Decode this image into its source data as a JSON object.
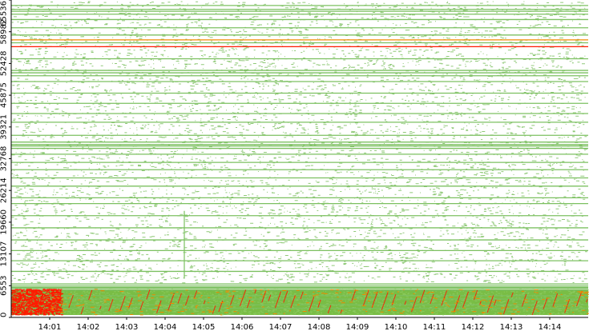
{
  "chart_data": {
    "type": "scatter",
    "y_axis": {
      "min": 0,
      "max": 65536,
      "ticks": [
        0,
        6553,
        13107,
        19660,
        26214,
        32768,
        39321,
        45875,
        52428,
        58982,
        65536
      ],
      "tick_labels": [
        "0",
        "6553",
        "13107",
        "19660",
        "26214",
        "32768",
        "39321",
        "45875",
        "52428",
        "58982",
        "65536"
      ]
    },
    "x_axis": {
      "min": "14:00",
      "max": "14:15",
      "ticks": [
        "14:01",
        "14:02",
        "14:03",
        "14:04",
        "14:05",
        "14:06",
        "14:07",
        "14:08",
        "14:09",
        "14:10",
        "14:11",
        "14:12",
        "14:13",
        "14:14"
      ],
      "tick_labels": [
        "14:01",
        "14:02",
        "14:03",
        "14:04",
        "14:05",
        "14:06",
        "14:07",
        "14:08",
        "14:09",
        "14:10",
        "14:11",
        "14:12",
        "14:13",
        "14:14"
      ]
    },
    "grid": false,
    "colors": {
      "normal": "#7cc060",
      "dense": "#6ab631",
      "hot": "#ff1a00",
      "line_orange": "#f08a00",
      "background": "#ffffff",
      "axis": "#000000"
    },
    "series": [
      {
        "color": "#7cc060",
        "horizontal_bands": [
          1900,
          2600,
          3800,
          4500,
          5600,
          6000,
          6200,
          6500,
          6900,
          9500,
          11700,
          13800,
          16000,
          18500,
          21000,
          23500,
          24700,
          27100,
          28800,
          30500,
          32000,
          33700,
          34900,
          35400,
          35700,
          36200,
          37600,
          40300,
          42100,
          44200,
          46300,
          48700,
          49900,
          50500,
          51000,
          53400,
          56700,
          58300,
          59800,
          61500,
          62600,
          63200,
          63600,
          64400
        ],
        "vertical_streaks": [
          {
            "time": "14:04:30",
            "y_range": [
              8000,
              22000
            ]
          }
        ]
      },
      {
        "color": "#ff1a00",
        "horizontal_bands": [
          55900
        ],
        "dense_region": {
          "time_range": [
            "14:00",
            "14:01"
          ],
          "y_range": [
            500,
            5800
          ]
        }
      },
      {
        "color": "#f08a00",
        "horizontal_bands": [
          57300
        ],
        "diagonal_streaks": {
          "time_range": [
            "14:01",
            "14:15"
          ],
          "y_range": [
            500,
            5800
          ]
        }
      }
    ]
  }
}
